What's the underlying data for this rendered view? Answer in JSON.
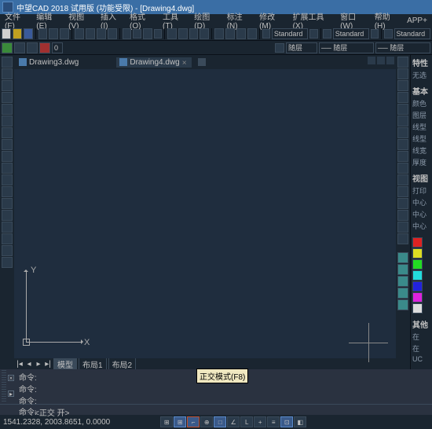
{
  "title": "中望CAD 2018 试用版 (功能受限) - [Drawing4.dwg]",
  "menu": [
    "文件(F)",
    "编辑(E)",
    "视图(V)",
    "插入(I)",
    "格式(O)",
    "工具(T)",
    "绘图(D)",
    "标注(N)",
    "修改(M)",
    "扩展工具(X)",
    "窗口(W)",
    "帮助(H)",
    "APP+"
  ],
  "toolbar2_dropdowns": {
    "color": "随层",
    "layer": "── 随层",
    "ltype": "── 随层",
    "std1": "Standard",
    "std2": "Standard",
    "std3": "Standard"
  },
  "tabs": [
    {
      "name": "Drawing3.dwg",
      "active": false
    },
    {
      "name": "Drawing4.dwg",
      "active": true
    }
  ],
  "bottom_tabs": {
    "model": "模型",
    "layout1": "布局1",
    "layout2": "布局2"
  },
  "axis": {
    "x": "X",
    "y": "Y"
  },
  "commandline": {
    "line1": "命令:",
    "line2": "命令:",
    "line3": "命令:",
    "line4": "<正交 开>"
  },
  "cmdprompt": "命令:",
  "status_coords": "1541.2328, 2003.8651, 0.0000",
  "tooltip": "正交模式(F8)",
  "rightpanel": {
    "sec1": "特性",
    "sec1_item": "无选",
    "sec2": "基本",
    "sec2_items": [
      "颜色",
      "图层",
      "线型",
      "线型",
      "线宽",
      "厚度"
    ],
    "sec3": "视图",
    "sec3_items": [
      "打印",
      "中心",
      "中心",
      "中心"
    ],
    "sec4": "其他",
    "sec4_items": [
      "在",
      "在",
      "UC"
    ]
  }
}
